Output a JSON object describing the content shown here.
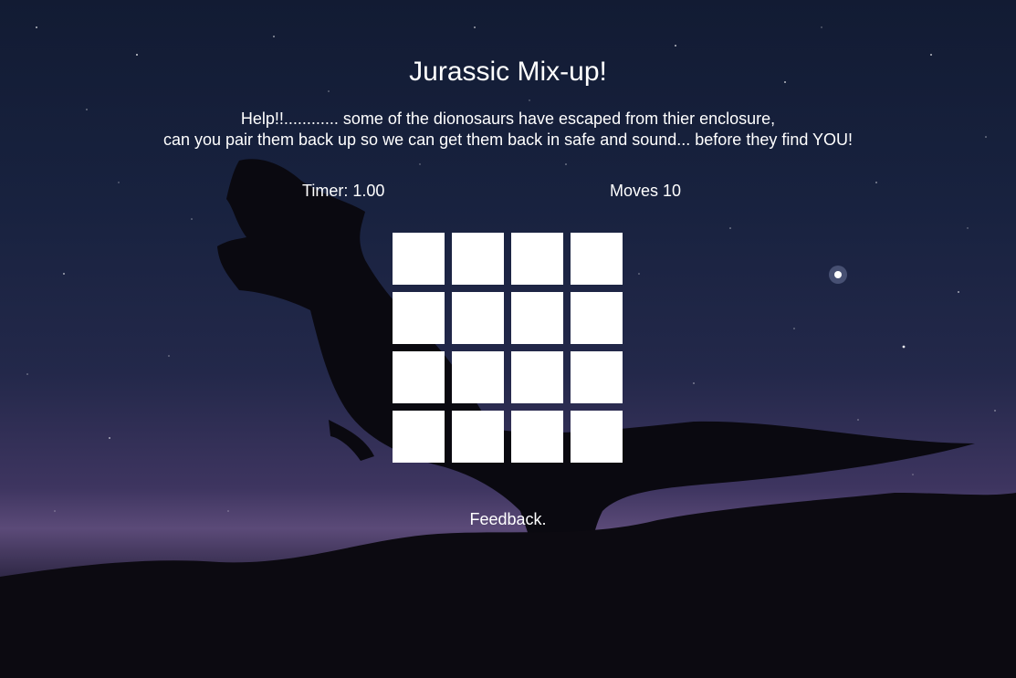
{
  "game": {
    "title": "Jurassic Mix-up!",
    "intro_line1": "Help!!............ some of the dionosaurs have escaped from thier enclosure,",
    "intro_line2": "can you pair them back up so we can get them back in safe and sound... before they find YOU!",
    "timer": "Timer: 1.00",
    "moves": "Moves 10",
    "feedback": "Feedback."
  },
  "board": {
    "rows": 4,
    "columns": 4,
    "cards": [
      {
        "face": "down"
      },
      {
        "face": "down"
      },
      {
        "face": "down"
      },
      {
        "face": "down"
      },
      {
        "face": "down"
      },
      {
        "face": "down"
      },
      {
        "face": "down"
      },
      {
        "face": "down"
      },
      {
        "face": "down"
      },
      {
        "face": "down"
      },
      {
        "face": "down"
      },
      {
        "face": "down"
      },
      {
        "face": "down"
      },
      {
        "face": "down"
      },
      {
        "face": "down"
      },
      {
        "face": "down"
      }
    ]
  },
  "background": {
    "subject": "t-rex-silhouette-night-sky",
    "sky_color": "#18223f",
    "horizon_glow": "#5b4a78",
    "silhouette_color": "#0a0910",
    "card_color": "#ffffff"
  }
}
